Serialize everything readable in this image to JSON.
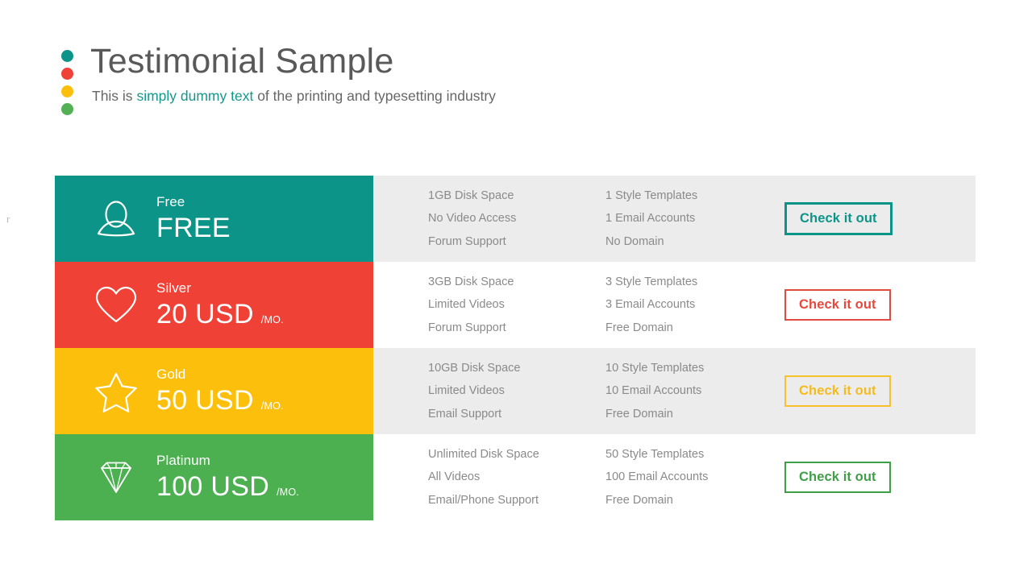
{
  "header": {
    "title": "Testimonial Sample",
    "subtitle_before": "This is ",
    "subtitle_accent": "simply dummy text",
    "subtitle_after": " of the printing and typesetting industry",
    "dots": [
      {
        "name": "dot-teal",
        "color": "#0d9488"
      },
      {
        "name": "dot-red",
        "color": "#ef4136"
      },
      {
        "name": "dot-yellow",
        "color": "#fcc00c"
      },
      {
        "name": "dot-green",
        "color": "#54b054"
      }
    ]
  },
  "colors": {
    "teal": "#0d9488",
    "red": "#ef4136",
    "yellow": "#fcc00c",
    "green": "#4caf50",
    "shaded_row": "#ececec",
    "plain_row": "#ffffff",
    "feature_text": "#8a8a8a",
    "title_text": "#595959"
  },
  "cta_label": "Check it out",
  "plans": [
    {
      "name": "Free",
      "price": "FREE",
      "period": "",
      "icon": "person-icon",
      "color": "#0d9488",
      "row_background": "#ececec",
      "button_border_color": "#0d9488",
      "button_text_color": "#0d9488",
      "button_border_width": "3px",
      "features_left": [
        "1GB Disk Space",
        "No Video Access",
        "Forum Support"
      ],
      "features_right": [
        "1 Style Templates",
        "1 Email Accounts",
        "No Domain"
      ]
    },
    {
      "name": "Silver",
      "price": "20 USD",
      "period": "/MO.",
      "icon": "heart-icon",
      "color": "#ef4136",
      "row_background": "#ffffff",
      "button_border_color": "#e04a3f",
      "button_text_color": "#e8483c",
      "button_border_width": "2px",
      "features_left": [
        "3GB Disk Space",
        "Limited Videos",
        "Forum Support"
      ],
      "features_right": [
        "3 Style Templates",
        "3 Email Accounts",
        "Free Domain"
      ]
    },
    {
      "name": "Gold",
      "price": "50 USD",
      "period": "/MO.",
      "icon": "star-icon",
      "color": "#fcc00c",
      "row_background": "#ececec",
      "button_border_color": "#f5c229",
      "button_text_color": "#f5bb1d",
      "button_border_width": "2px",
      "features_left": [
        "10GB Disk Space",
        "Limited Videos",
        "Email Support"
      ],
      "features_right": [
        "10 Style Templates",
        "10 Email Accounts",
        "Free Domain"
      ]
    },
    {
      "name": "Platinum",
      "price": "100 USD",
      "period": "/MO.",
      "icon": "diamond-icon",
      "color": "#4caf50",
      "row_background": "#ffffff",
      "button_border_color": "#3f9f46",
      "button_text_color": "#3f9f46",
      "button_border_width": "2px",
      "features_left": [
        "Unlimited Disk Space",
        "All Videos",
        "Email/Phone Support"
      ],
      "features_right": [
        "50 Style Templates",
        "100 Email Accounts",
        "Free Domain"
      ]
    }
  ],
  "edge_mark": "r"
}
